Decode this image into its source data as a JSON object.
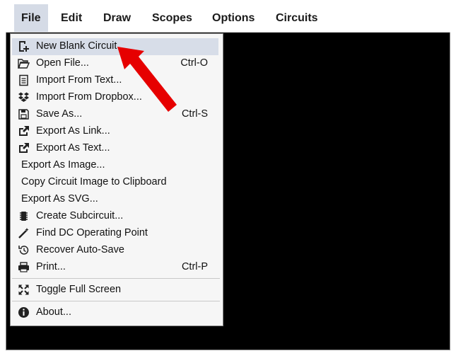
{
  "menubar": {
    "items": [
      {
        "label": "File",
        "active": true
      },
      {
        "label": "Edit"
      },
      {
        "label": "Draw"
      },
      {
        "label": "Scopes"
      },
      {
        "label": "Options"
      },
      {
        "label": "Circuits"
      }
    ]
  },
  "file_menu": {
    "items": [
      {
        "label": "New Blank Circuit",
        "shortcut": "",
        "icon": "new-circuit-icon",
        "highlighted": true
      },
      {
        "label": "Open File...",
        "shortcut": "Ctrl-O",
        "icon": "folder-open-icon"
      },
      {
        "label": "Import From Text...",
        "shortcut": "",
        "icon": "text-file-icon"
      },
      {
        "label": "Import From Dropbox...",
        "shortcut": "",
        "icon": "dropbox-icon"
      },
      {
        "label": "Save As...",
        "shortcut": "Ctrl-S",
        "icon": "save-icon"
      },
      {
        "label": "Export As Link...",
        "shortcut": "",
        "icon": "export-icon"
      },
      {
        "label": "Export As Text...",
        "shortcut": "",
        "icon": "export-icon"
      },
      {
        "label": "Export As Image...",
        "shortcut": ""
      },
      {
        "label": "Copy Circuit Image to Clipboard",
        "shortcut": ""
      },
      {
        "label": "Export As SVG...",
        "shortcut": ""
      },
      {
        "label": "Create Subcircuit...",
        "shortcut": "",
        "icon": "chip-icon"
      },
      {
        "label": "Find DC Operating Point",
        "shortcut": "",
        "icon": "wand-icon"
      },
      {
        "label": "Recover Auto-Save",
        "shortcut": "",
        "icon": "history-icon"
      },
      {
        "label": "Print...",
        "shortcut": "Ctrl-P",
        "icon": "print-icon"
      },
      {
        "label": "Toggle Full Screen",
        "shortcut": "",
        "icon": "fullscreen-icon"
      },
      {
        "label": "About...",
        "shortcut": "",
        "icon": "info-icon"
      }
    ]
  },
  "colors": {
    "highlight": "#d7dde8",
    "arrow": "#e60000",
    "canvas": "#000000"
  }
}
